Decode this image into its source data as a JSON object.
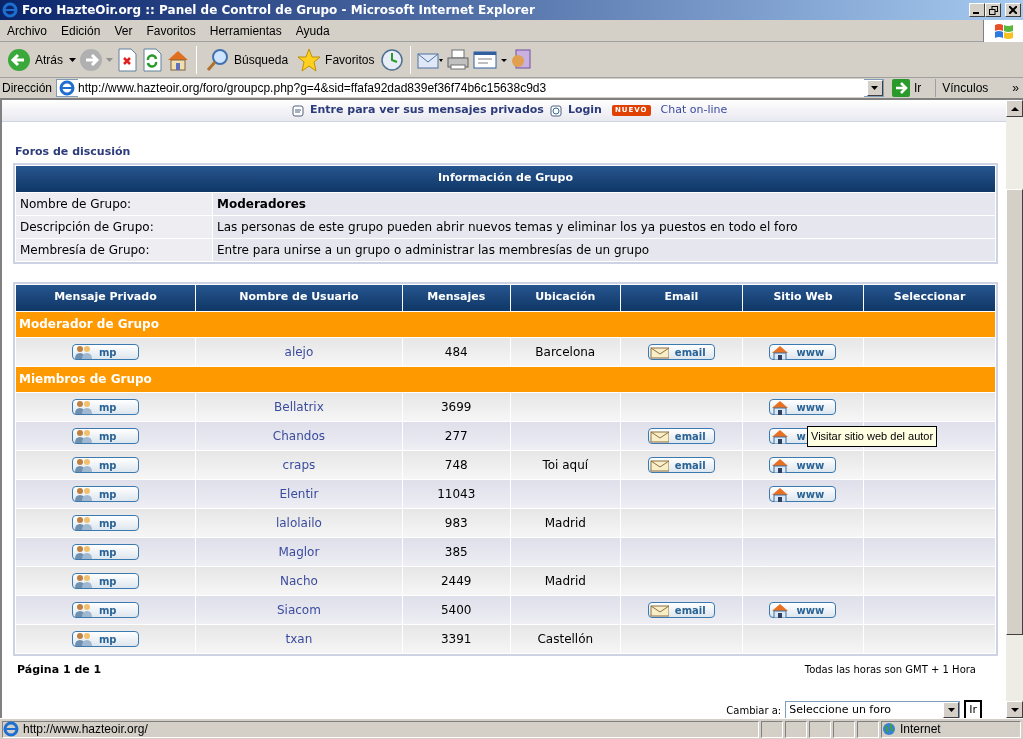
{
  "window": {
    "title": "Foro HazteOir.org :: Panel de Control de Grupo - Microsoft Internet Explorer"
  },
  "menu": [
    "Archivo",
    "Edición",
    "Ver",
    "Favoritos",
    "Herramientas",
    "Ayuda"
  ],
  "toolbar": {
    "back": "Atrás",
    "search": "Búsqueda",
    "favorites": "Favoritos"
  },
  "address": {
    "label": "Dirección",
    "url": "http://www.hazteoir.org/foro/groupcp.php?g=4&sid=ffafa92dad839ef36f74b6c15638c9d3",
    "go": "Ir",
    "links": "Vínculos",
    "more": "»"
  },
  "page": {
    "top_links": [
      "Entre para ver sus mensajes privados",
      "Login"
    ],
    "badge": "NUEVO",
    "chat": "Chat on-line",
    "breadcrumb": "Foros de discusión",
    "info": {
      "title": "Información de Grupo",
      "rows": [
        {
          "label": "Nombre de Grupo:",
          "value": "Moderadores",
          "bold": true
        },
        {
          "label": "Descripción de Grupo:",
          "value": "Las personas de este grupo pueden abrir nuevos temas y eliminar los ya puestos en todo el foro",
          "bold": false
        },
        {
          "label": "Membresía de Grupo:",
          "value": "Entre para unirse a un grupo o administrar las membresías de un grupo",
          "bold": false
        }
      ]
    },
    "members": {
      "columns": [
        "Mensaje Privado",
        "Nombre de Usuario",
        "Mensajes",
        "Ubicación",
        "Email",
        "Sitio Web",
        "Seleccionar"
      ],
      "groups": [
        {
          "title": "Moderador de Grupo",
          "rows": [
            {
              "pm": "mp",
              "user": "alejo",
              "posts": "484",
              "location": "Barcelona",
              "email": "email",
              "website": "www"
            }
          ]
        },
        {
          "title": "Miembros de Grupo",
          "rows": [
            {
              "pm": "mp",
              "user": "Bellatrix",
              "posts": "3699",
              "website": "www"
            },
            {
              "pm": "mp",
              "user": "Chandos",
              "posts": "277",
              "email": "email",
              "website": "w"
            },
            {
              "pm": "mp",
              "user": "craps",
              "posts": "748",
              "location": "Toi aquí",
              "email": "email",
              "website": "www"
            },
            {
              "pm": "mp",
              "user": "Elentir",
              "posts": "11043",
              "website": "www"
            },
            {
              "pm": "mp",
              "user": "lalolailo",
              "posts": "983",
              "location": "Madrid"
            },
            {
              "pm": "mp",
              "user": "Maglor",
              "posts": "385"
            },
            {
              "pm": "mp",
              "user": "Nacho",
              "posts": "2449",
              "location": "Madrid"
            },
            {
              "pm": "mp",
              "user": "Siacom",
              "posts": "5400",
              "email": "email",
              "website": "www"
            },
            {
              "pm": "mp",
              "user": "txan",
              "posts": "3391",
              "location": "Castellón"
            }
          ]
        }
      ]
    },
    "pagination": "Página 1 de 1",
    "timezone": "Todas las horas son GMT + 1 Hora",
    "jump": {
      "label": "Cambiar a:",
      "value": "Seleccione un foro",
      "button": "Ir"
    },
    "tooltip": "Visitar sitio web del autor"
  },
  "status_bar": {
    "url": "http://www.hazteoir.org/",
    "zone": "Internet"
  }
}
